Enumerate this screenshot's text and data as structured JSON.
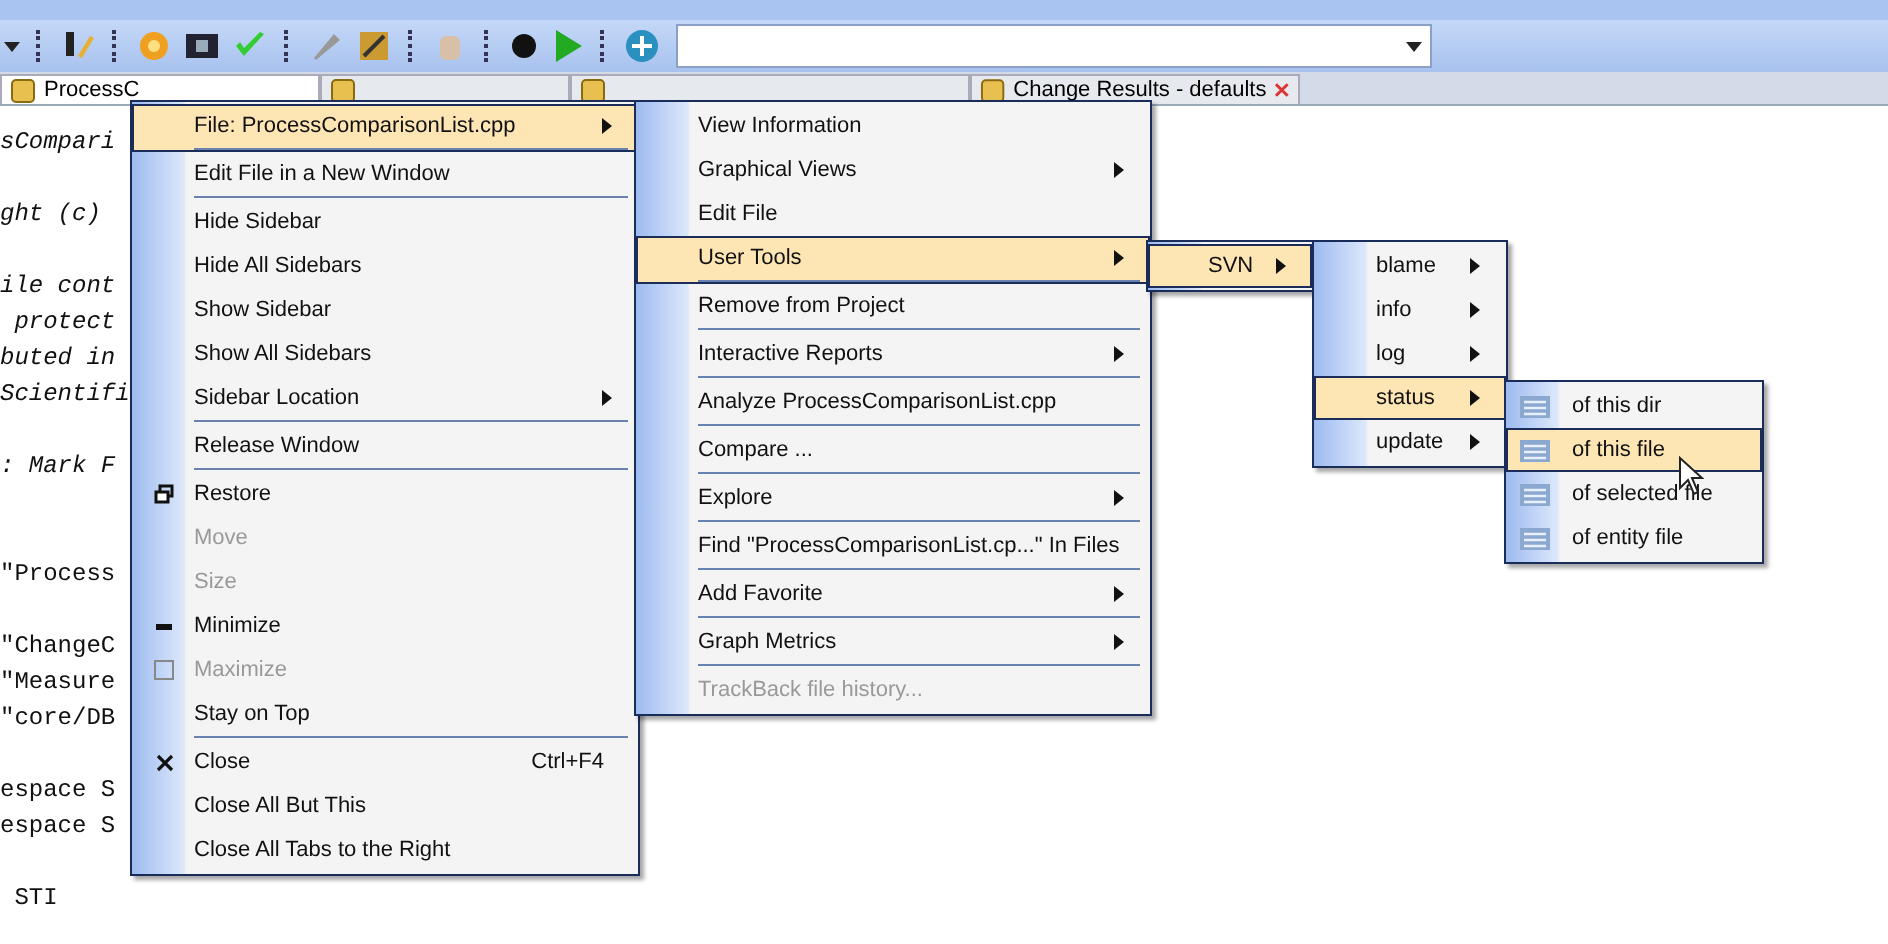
{
  "tabs": [
    {
      "label": "ProcessC",
      "selected": true,
      "closable": false
    },
    {
      "selected": false,
      "closable": false
    },
    {
      "selected": false,
      "closable": false
    },
    {
      "label": "Change Results - defaults",
      "selected": false,
      "closable": true
    }
  ],
  "editor": {
    "lines": [
      {
        "kind": "comment",
        "text": "sCompari"
      },
      {
        "kind": "blank"
      },
      {
        "kind": "comment",
        "text": "ght (c)"
      },
      {
        "kind": "blank"
      },
      {
        "kind": "comment",
        "text": "ile cont"
      },
      {
        "kind": "comment",
        "text": " protect"
      },
      {
        "kind": "comment",
        "text": "buted in"
      },
      {
        "kind": "comment",
        "text": "Scientifi"
      },
      {
        "kind": "blank"
      },
      {
        "kind": "comment",
        "text": ": Mark F"
      },
      {
        "kind": "blank"
      },
      {
        "kind": "blank"
      },
      {
        "kind": "string",
        "text": "\"Process"
      },
      {
        "kind": "blank"
      },
      {
        "kind": "string",
        "text": "\"ChangeC"
      },
      {
        "kind": "string",
        "text": "\"Measure"
      },
      {
        "kind": "string",
        "text": "\"core/DB"
      },
      {
        "kind": "blank"
      },
      {
        "kind": "code",
        "text": "espace S"
      },
      {
        "kind": "code",
        "text": "espace S"
      },
      {
        "kind": "blank"
      },
      {
        "kind": "code",
        "text": " STI"
      }
    ]
  },
  "menus": [
    {
      "items": [
        {
          "label": "File: ProcessComparisonList.cpp",
          "submenu": true,
          "selected": true,
          "disabled": false,
          "separator": true
        },
        {
          "label": "Edit File in a New Window",
          "submenu": false,
          "selected": false,
          "disabled": false,
          "separator": true
        },
        {
          "label": "Hide Sidebar",
          "submenu": false,
          "selected": false,
          "disabled": false,
          "separator": false
        },
        {
          "label": "Hide All Sidebars",
          "submenu": false,
          "selected": false,
          "disabled": false,
          "separator": false
        },
        {
          "label": "Show Sidebar",
          "submenu": false,
          "selected": false,
          "disabled": false,
          "separator": false
        },
        {
          "label": "Show All Sidebars",
          "submenu": false,
          "selected": false,
          "disabled": false,
          "separator": false
        },
        {
          "label": "Sidebar Location",
          "submenu": true,
          "selected": false,
          "disabled": false,
          "separator": true
        },
        {
          "label": "Release Window",
          "submenu": false,
          "selected": false,
          "disabled": false,
          "separator": true
        },
        {
          "label": "Restore",
          "submenu": false,
          "selected": false,
          "disabled": false,
          "separator": false
        },
        {
          "label": "Move",
          "submenu": false,
          "selected": false,
          "disabled": true,
          "separator": false
        },
        {
          "label": "Size",
          "submenu": false,
          "selected": false,
          "disabled": true,
          "separator": false
        },
        {
          "label": "Minimize",
          "submenu": false,
          "selected": false,
          "disabled": false,
          "separator": false
        },
        {
          "label": "Maximize",
          "submenu": false,
          "selected": false,
          "disabled": true,
          "separator": false
        },
        {
          "label": "Stay on Top",
          "submenu": false,
          "selected": false,
          "disabled": false,
          "separator": true
        },
        {
          "label": "Close",
          "shortcut": "Ctrl+F4",
          "submenu": false,
          "selected": false,
          "disabled": false,
          "separator": false
        },
        {
          "label": "Close All But This",
          "submenu": false,
          "selected": false,
          "disabled": false,
          "separator": false
        },
        {
          "label": "Close All Tabs to the Right",
          "submenu": false,
          "selected": false,
          "disabled": false,
          "separator": false
        }
      ]
    },
    {
      "items": [
        {
          "label": "View Information",
          "submenu": false,
          "selected": false,
          "disabled": false,
          "separator": false
        },
        {
          "label": "Graphical Views",
          "submenu": true,
          "selected": false,
          "disabled": false,
          "separator": false
        },
        {
          "label": "Edit File",
          "submenu": false,
          "selected": false,
          "disabled": false,
          "separator": false
        },
        {
          "label": "User Tools",
          "submenu": true,
          "selected": true,
          "disabled": false,
          "separator": true
        },
        {
          "label": "Remove from Project",
          "submenu": false,
          "selected": false,
          "disabled": false,
          "separator": true
        },
        {
          "label": "Interactive Reports",
          "submenu": true,
          "selected": false,
          "disabled": false,
          "separator": true
        },
        {
          "label": "Analyze ProcessComparisonList.cpp",
          "submenu": false,
          "selected": false,
          "disabled": false,
          "separator": true
        },
        {
          "label": "Compare ...",
          "submenu": false,
          "selected": false,
          "disabled": false,
          "separator": true
        },
        {
          "label": "Explore",
          "submenu": true,
          "selected": false,
          "disabled": false,
          "separator": true
        },
        {
          "label": "Find \"ProcessComparisonList.cp...\" In Files",
          "submenu": false,
          "selected": false,
          "disabled": false,
          "separator": true
        },
        {
          "label": "Add Favorite",
          "submenu": true,
          "selected": false,
          "disabled": false,
          "separator": true
        },
        {
          "label": "Graph Metrics",
          "submenu": true,
          "selected": false,
          "disabled": false,
          "separator": true
        },
        {
          "label": "TrackBack file history...",
          "submenu": false,
          "selected": false,
          "disabled": true,
          "separator": false
        }
      ]
    },
    {
      "items": [
        {
          "label": "SVN",
          "submenu": true,
          "selected": true,
          "disabled": false,
          "separator": false
        }
      ]
    },
    {
      "items": [
        {
          "label": "blame",
          "submenu": true,
          "selected": false,
          "disabled": false,
          "separator": false
        },
        {
          "label": "info",
          "submenu": true,
          "selected": false,
          "disabled": false,
          "separator": false
        },
        {
          "label": "log",
          "submenu": true,
          "selected": false,
          "disabled": false,
          "separator": false
        },
        {
          "label": "status",
          "submenu": true,
          "selected": true,
          "disabled": false,
          "separator": false
        },
        {
          "label": "update",
          "submenu": true,
          "selected": false,
          "disabled": false,
          "separator": false
        }
      ]
    },
    {
      "items": [
        {
          "label": "of this dir",
          "submenu": false,
          "selected": false,
          "disabled": false,
          "separator": false
        },
        {
          "label": "of this file",
          "submenu": false,
          "selected": true,
          "disabled": false,
          "separator": false
        },
        {
          "label": "of selected file",
          "submenu": false,
          "selected": false,
          "disabled": false,
          "separator": false
        },
        {
          "label": "of entity file",
          "submenu": false,
          "selected": false,
          "disabled": false,
          "separator": false
        }
      ]
    }
  ]
}
